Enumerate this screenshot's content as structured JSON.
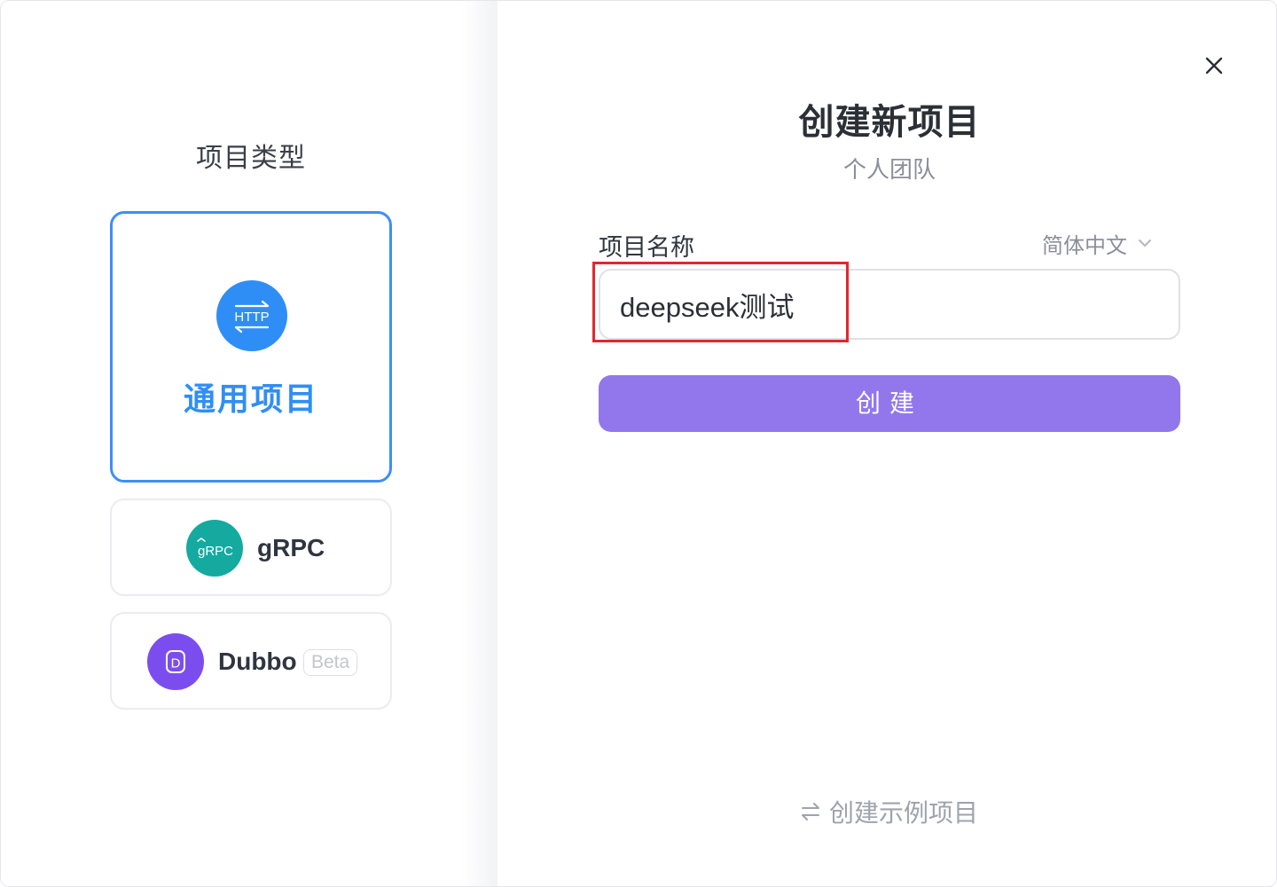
{
  "left_panel": {
    "title": "项目类型",
    "types": [
      {
        "label": "通用项目",
        "icon": "http-icon",
        "icon_text": "HTTP",
        "selected": true,
        "color": "#2f8ef5"
      },
      {
        "label": "gRPC",
        "icon": "grpc-icon",
        "icon_text": "gRPC",
        "selected": false,
        "color": "#14aaa0"
      },
      {
        "label": "Dubbo",
        "icon": "dubbo-icon",
        "icon_text": "D",
        "badge": "Beta",
        "selected": false,
        "color": "#7c4dee"
      }
    ]
  },
  "dialog": {
    "title": "创建新项目",
    "subtitle": "个人团队",
    "close_icon": "close-icon"
  },
  "form": {
    "name_label": "项目名称",
    "language": "简体中文",
    "name_value": "deepseek测试",
    "create_label": "创建",
    "create_color": "#9277ec"
  },
  "footer": {
    "example_label": "创建示例项目",
    "example_icon": "swap-icon"
  }
}
